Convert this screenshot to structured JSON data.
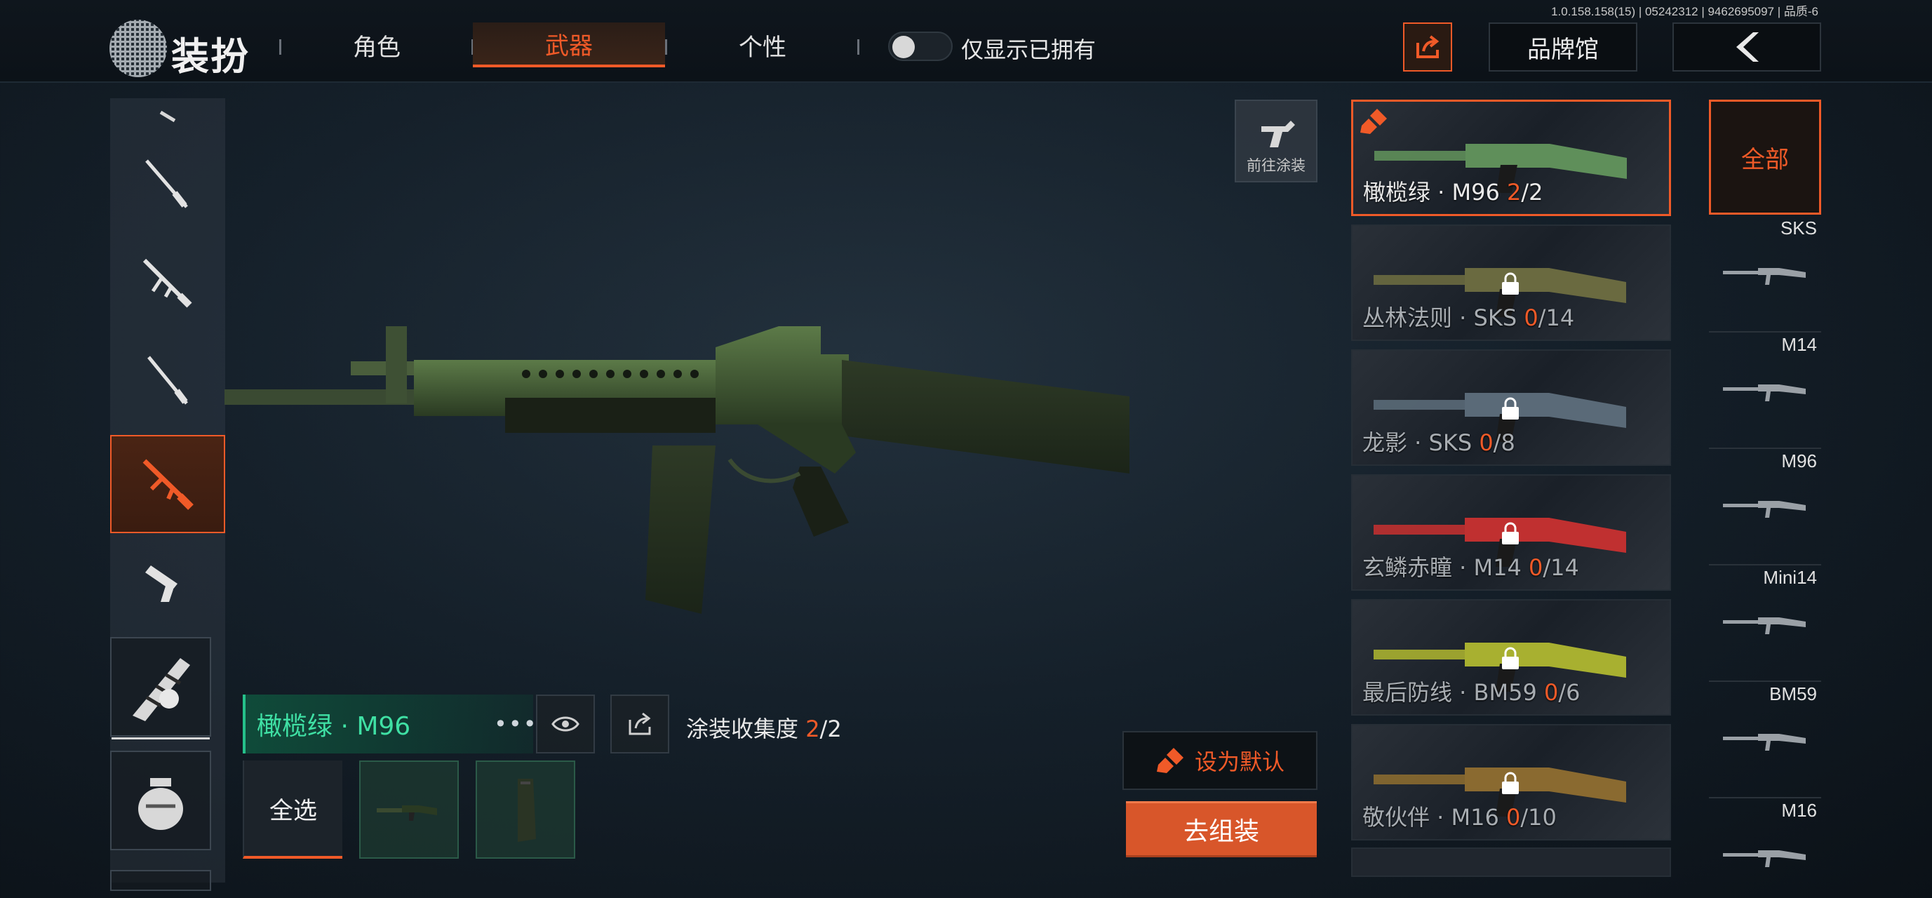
{
  "app": {
    "title": "装扮",
    "version": "1.0.158.158(15) | 05242312 | 9462695097 | 品质-6"
  },
  "tabs": [
    {
      "label": "角色",
      "active": false
    },
    {
      "label": "武器",
      "active": true
    },
    {
      "label": "个性",
      "active": false
    }
  ],
  "filter": {
    "owned_only_label": "仅显示已拥有",
    "owned_only": false
  },
  "header_buttons": {
    "brand_hall": "品牌馆"
  },
  "goto_paint": {
    "label": "前往涂装"
  },
  "selected": {
    "name": "橄榄绿 · M96",
    "collection_label": "涂装收集度",
    "collection_owned": "2",
    "collection_total": "/2",
    "select_all": "全选"
  },
  "actions": {
    "set_default": "设为默认",
    "go_assemble": "去组装"
  },
  "skins": [
    {
      "name": "橄榄绿 · M96 ",
      "owned": "2",
      "total": "/2",
      "locked": false,
      "active": true,
      "color": "#5f8f5a"
    },
    {
      "name": "丛林法则 · SKS ",
      "owned": "0",
      "total": "/14",
      "locked": true,
      "active": false,
      "color": "#6a6a40"
    },
    {
      "name": "龙影 · SKS ",
      "owned": "0",
      "total": "/8",
      "locked": true,
      "active": false,
      "color": "#5a6a78"
    },
    {
      "name": "玄鳞赤瞳 · M14 ",
      "owned": "0",
      "total": "/14",
      "locked": true,
      "active": false,
      "color": "#c03030"
    },
    {
      "name": "最后防线 · BM59 ",
      "owned": "0",
      "total": "/6",
      "locked": true,
      "active": false,
      "color": "#a8b030"
    },
    {
      "name": "敬伙伴 · M16 ",
      "owned": "0",
      "total": "/10",
      "locked": true,
      "active": false,
      "color": "#8a6a30"
    }
  ],
  "categories": [
    {
      "label": "全部",
      "active": true
    },
    {
      "label": "SKS"
    },
    {
      "label": "M14"
    },
    {
      "label": "M96"
    },
    {
      "label": "Mini14"
    },
    {
      "label": "BM59"
    },
    {
      "label": "M16"
    }
  ],
  "colors": {
    "accent": "#f05a28",
    "selected_green": "#3fe0a4"
  }
}
